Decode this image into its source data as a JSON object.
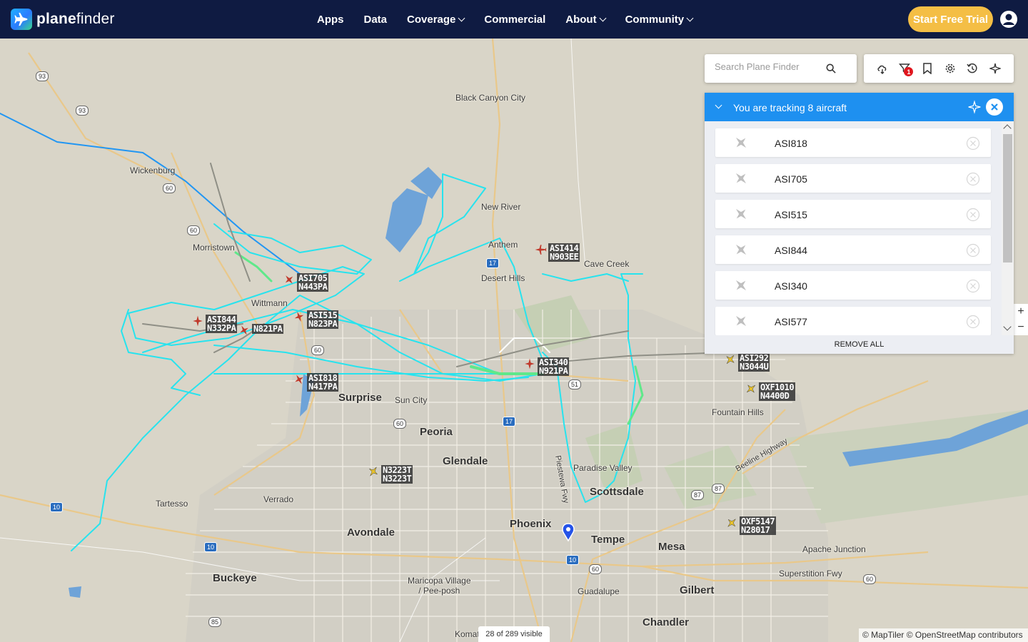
{
  "brand": {
    "name_bold": "plane",
    "name_light": "finder"
  },
  "nav": {
    "items": [
      {
        "label": "Apps",
        "dropdown": false
      },
      {
        "label": "Data",
        "dropdown": false
      },
      {
        "label": "Coverage",
        "dropdown": true
      },
      {
        "label": "Commercial",
        "dropdown": false
      },
      {
        "label": "About",
        "dropdown": true
      },
      {
        "label": "Community",
        "dropdown": true
      }
    ],
    "trial_label": "Start Free Trial"
  },
  "search": {
    "placeholder": "Search Plane Finder",
    "value": ""
  },
  "toolbar": {
    "icons": [
      "weather-icon",
      "filter-icon",
      "bookmark-icon",
      "settings-icon",
      "playback-icon",
      "airport-icon"
    ],
    "filter_badge": "1"
  },
  "tracking": {
    "title": "You are tracking 8 aircraft",
    "items": [
      "ASI818",
      "ASI705",
      "ASI515",
      "ASI844",
      "ASI340",
      "ASI577"
    ],
    "remove_all_label": "REMOVE ALL"
  },
  "map": {
    "places": [
      {
        "name": "Black Canyon City",
        "size": "small"
      },
      {
        "name": "Wickenburg",
        "size": "small"
      },
      {
        "name": "New River",
        "size": "small"
      },
      {
        "name": "Morristown",
        "size": "small"
      },
      {
        "name": "Anthem",
        "size": "small"
      },
      {
        "name": "Cave Creek",
        "size": "small"
      },
      {
        "name": "Desert Hills",
        "size": "small"
      },
      {
        "name": "Wittmann",
        "size": "small"
      },
      {
        "name": "Surprise",
        "size": "med"
      },
      {
        "name": "Sun City",
        "size": "small"
      },
      {
        "name": "Fountain Hills",
        "size": "small"
      },
      {
        "name": "Peoria",
        "size": "med"
      },
      {
        "name": "Glendale",
        "size": "med"
      },
      {
        "name": "Paradise Valley",
        "size": "small"
      },
      {
        "name": "Scottsdale",
        "size": "med"
      },
      {
        "name": "Tartesso",
        "size": "small"
      },
      {
        "name": "Verrado",
        "size": "small"
      },
      {
        "name": "Phoenix",
        "size": "med"
      },
      {
        "name": "Avondale",
        "size": "med"
      },
      {
        "name": "Tempe",
        "size": "med"
      },
      {
        "name": "Mesa",
        "size": "med"
      },
      {
        "name": "Apache Junction",
        "size": "small"
      },
      {
        "name": "Buckeye",
        "size": "med"
      },
      {
        "name": "Maricopa Village\n/ Pee-posh",
        "size": "small"
      },
      {
        "name": "Guadalupe",
        "size": "small"
      },
      {
        "name": "Gilbert",
        "size": "med"
      },
      {
        "name": "Superstition Fwy",
        "size": "small"
      },
      {
        "name": "Chandler",
        "size": "med"
      },
      {
        "name": "Komat",
        "size": "small"
      },
      {
        "name": "Beeline Highway",
        "size": "small"
      },
      {
        "name": "Piestewa Fwy",
        "size": "small"
      }
    ],
    "road_shields": [
      "93",
      "93",
      "60",
      "60",
      "17",
      "17",
      "51",
      "60",
      "10",
      "10",
      "10",
      "60",
      "87",
      "87",
      "60",
      "85",
      "60"
    ],
    "aircraft": [
      {
        "label": "ASI414\nN903EE",
        "color": "#c0392b"
      },
      {
        "label": "ASI705\nN443PA",
        "color": "#c0392b"
      },
      {
        "label": "ASI844\nN332PA",
        "color": "#c0392b"
      },
      {
        "label": "N821PA",
        "color": "#c0392b"
      },
      {
        "label": "ASI515\nN823PA",
        "color": "#c0392b"
      },
      {
        "label": "ASI340\nN921PA",
        "color": "#c0392b"
      },
      {
        "label": "ASI818\nN417PA",
        "color": "#c0392b"
      },
      {
        "label": "ASI292\nN3044U",
        "color": "#e8c22a"
      },
      {
        "label": "OXF1010\nN4400D",
        "color": "#e8c22a"
      },
      {
        "label": "N3223T\nN3223T",
        "color": "#e8c22a"
      },
      {
        "label": "OXF5147\nN28017",
        "color": "#e8c22a"
      }
    ],
    "visible_count": "28 of 289 visible",
    "attribution": "© MapTiler © OpenStreetMap contributors",
    "zoom_in": "+",
    "zoom_out": "−"
  }
}
